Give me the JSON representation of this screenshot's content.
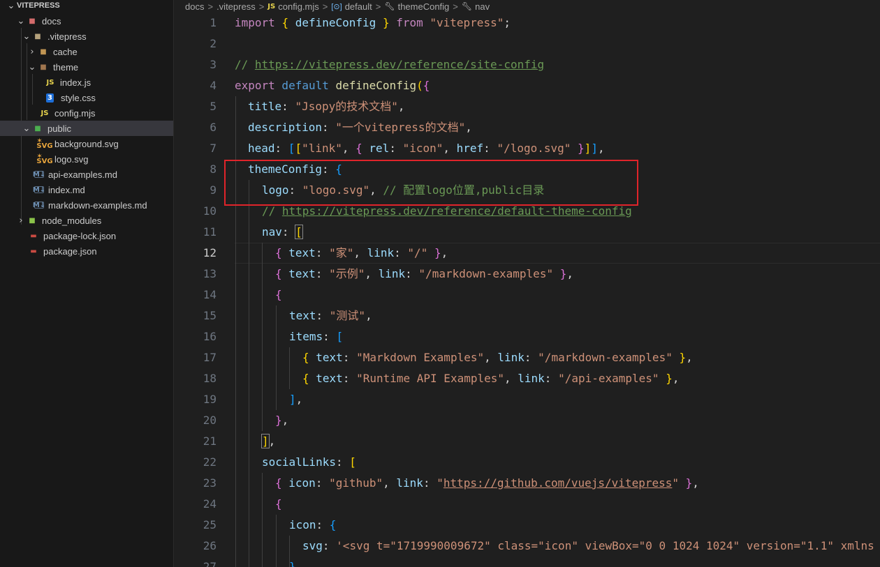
{
  "explorer": {
    "root": "VITEPRESS",
    "items": [
      {
        "label": "docs",
        "icon": "folder-docs-icon",
        "type": "folder-open"
      },
      {
        "label": ".vitepress",
        "icon": "folder-vitepress-icon",
        "type": "folder-open"
      },
      {
        "label": "cache",
        "icon": "folder-icon",
        "type": "folder-closed"
      },
      {
        "label": "theme",
        "icon": "folder-theme-icon",
        "type": "folder-open"
      },
      {
        "label": "index.js",
        "icon": "js-file-icon",
        "type": "file"
      },
      {
        "label": "style.css",
        "icon": "css-file-icon",
        "type": "file"
      },
      {
        "label": "config.mjs",
        "icon": "js-file-icon",
        "type": "file"
      },
      {
        "label": "public",
        "icon": "folder-public-icon",
        "type": "folder-open"
      },
      {
        "label": "background.svg",
        "icon": "svg-file-icon",
        "type": "file"
      },
      {
        "label": "logo.svg",
        "icon": "svg-file-icon",
        "type": "file"
      },
      {
        "label": "api-examples.md",
        "icon": "markdown-file-icon",
        "type": "file"
      },
      {
        "label": "index.md",
        "icon": "markdown-file-icon",
        "type": "file"
      },
      {
        "label": "markdown-examples.md",
        "icon": "markdown-file-icon",
        "type": "file"
      },
      {
        "label": "node_modules",
        "icon": "folder-node-icon",
        "type": "folder-closed"
      },
      {
        "label": "package-lock.json",
        "icon": "json-file-icon",
        "type": "file"
      },
      {
        "label": "package.json",
        "icon": "json-file-icon",
        "type": "file"
      }
    ],
    "selected": "public"
  },
  "breadcrumb": {
    "items": [
      "docs",
      ".vitepress",
      "config.mjs",
      "default",
      "themeConfig",
      "nav"
    ],
    "icons": [
      "",
      "",
      "js-icon",
      "object-icon",
      "wrench-icon",
      "wrench-icon"
    ],
    "file_icon_text": "JS",
    "separator": ">"
  },
  "editor": {
    "active_line": 12,
    "line_numbers": [
      "1",
      "2",
      "3",
      "4",
      "5",
      "6",
      "7",
      "8",
      "9",
      "10",
      "11",
      "12",
      "13",
      "14",
      "15",
      "16",
      "17",
      "18",
      "19",
      "20",
      "21",
      "22",
      "23",
      "24",
      "25",
      "26",
      "27"
    ],
    "tokens": {
      "l1_import": "import",
      "l1_open": "{",
      "l1_name": " defineConfig ",
      "l1_close": "}",
      "l1_from": " from ",
      "l1_mod": "\"vitepress\"",
      "l1_semi": ";",
      "l3_comment": "// ",
      "l3_url": "https://vitepress.dev/reference/site-config",
      "l4_export": "export",
      "l4_default": " default ",
      "l4_fn": "defineConfig",
      "l4_paren": "(",
      "l4_brace": "{",
      "l5_key": "title",
      "l5_colon": ": ",
      "l5_val": "\"Jsopy的技术文档\"",
      "l5_comma": ",",
      "l6_key": "description",
      "l6_colon": ": ",
      "l6_val": "\"一个vitepress的文档\"",
      "l6_comma": ",",
      "l7_key": "head",
      "l7_colon": ": ",
      "l7_b1": "[",
      "l7_b2": "[",
      "l7_s1": "\"link\"",
      "l7_c1": ", ",
      "l7_ob": "{",
      "l7_k1": " rel",
      "l7_c2": ": ",
      "l7_s2": "\"icon\"",
      "l7_c3": ", ",
      "l7_k2": "href",
      "l7_c4": ": ",
      "l7_s3": "\"/logo.svg\"",
      "l7_cb": " }",
      "l7_e2": "]",
      "l7_e1": "]",
      "l7_comma": ",",
      "l8_key": "themeConfig",
      "l8_colon": ": ",
      "l8_brace": "{",
      "l9_key": "logo",
      "l9_colon": ": ",
      "l9_val": "\"logo.svg\"",
      "l9_comma": ", ",
      "l9_comment": "// 配置logo位置,public目录",
      "l10_comment": "// ",
      "l10_url": "https://vitepress.dev/reference/default-theme-config",
      "l11_key": "nav",
      "l11_colon": ": ",
      "l11_br": "[",
      "l12_ob": "{",
      "l12_k1": " text",
      "l12_c1": ": ",
      "l12_s1": "\"家\"",
      "l12_c2": ", ",
      "l12_k2": "link",
      "l12_c3": ": ",
      "l12_s2": "\"/\"",
      "l12_cb": " }",
      "l12_comma": ",",
      "l13_ob": "{",
      "l13_k1": " text",
      "l13_c1": ": ",
      "l13_s1": "\"示例\"",
      "l13_c2": ", ",
      "l13_k2": "link",
      "l13_c3": ": ",
      "l13_s2": "\"/markdown-examples\"",
      "l13_cb": " }",
      "l13_comma": ",",
      "l14_ob": "{",
      "l15_key": "text",
      "l15_colon": ": ",
      "l15_val": "\"测试\"",
      "l15_comma": ",",
      "l16_key": "items",
      "l16_colon": ": ",
      "l16_br": "[",
      "l17_ob": "{",
      "l17_k1": " text",
      "l17_c1": ": ",
      "l17_s1": "\"Markdown Examples\"",
      "l17_c2": ", ",
      "l17_k2": "link",
      "l17_c3": ": ",
      "l17_s2": "\"/markdown-examples\"",
      "l17_cb": " }",
      "l17_comma": ",",
      "l18_ob": "{",
      "l18_k1": " text",
      "l18_c1": ": ",
      "l18_s1": "\"Runtime API Examples\"",
      "l18_c2": ", ",
      "l18_k2": "link",
      "l18_c3": ": ",
      "l18_s2": "\"/api-examples\"",
      "l18_cb": " }",
      "l18_comma": ",",
      "l19_br": "]",
      "l19_comma": ",",
      "l20_cb": "}",
      "l20_comma": ",",
      "l21_br": "]",
      "l21_comma": ",",
      "l22_key": "socialLinks",
      "l22_colon": ": ",
      "l22_br": "[",
      "l23_ob": "{",
      "l23_k1": " icon",
      "l23_c1": ": ",
      "l23_s1": "\"github\"",
      "l23_c2": ", ",
      "l23_k2": "link",
      "l23_c3": ": ",
      "l23_q1": "\"",
      "l23_url": "https://github.com/vuejs/vitepress",
      "l23_q2": "\"",
      "l23_cb": " }",
      "l23_comma": ",",
      "l24_ob": "{",
      "l25_key": "icon",
      "l25_colon": ": ",
      "l25_ob": "{",
      "l26_key": "svg",
      "l26_colon": ": ",
      "l26_val": "'<svg t=\"1719990009672\" class=\"icon\" viewBox=\"0 0 1024 1024\" version=\"1.1\" xmlns",
      "l27_cb": "},"
    }
  },
  "colors": {
    "annotation_box": "#e0242a",
    "selected_row": "#37373d"
  }
}
